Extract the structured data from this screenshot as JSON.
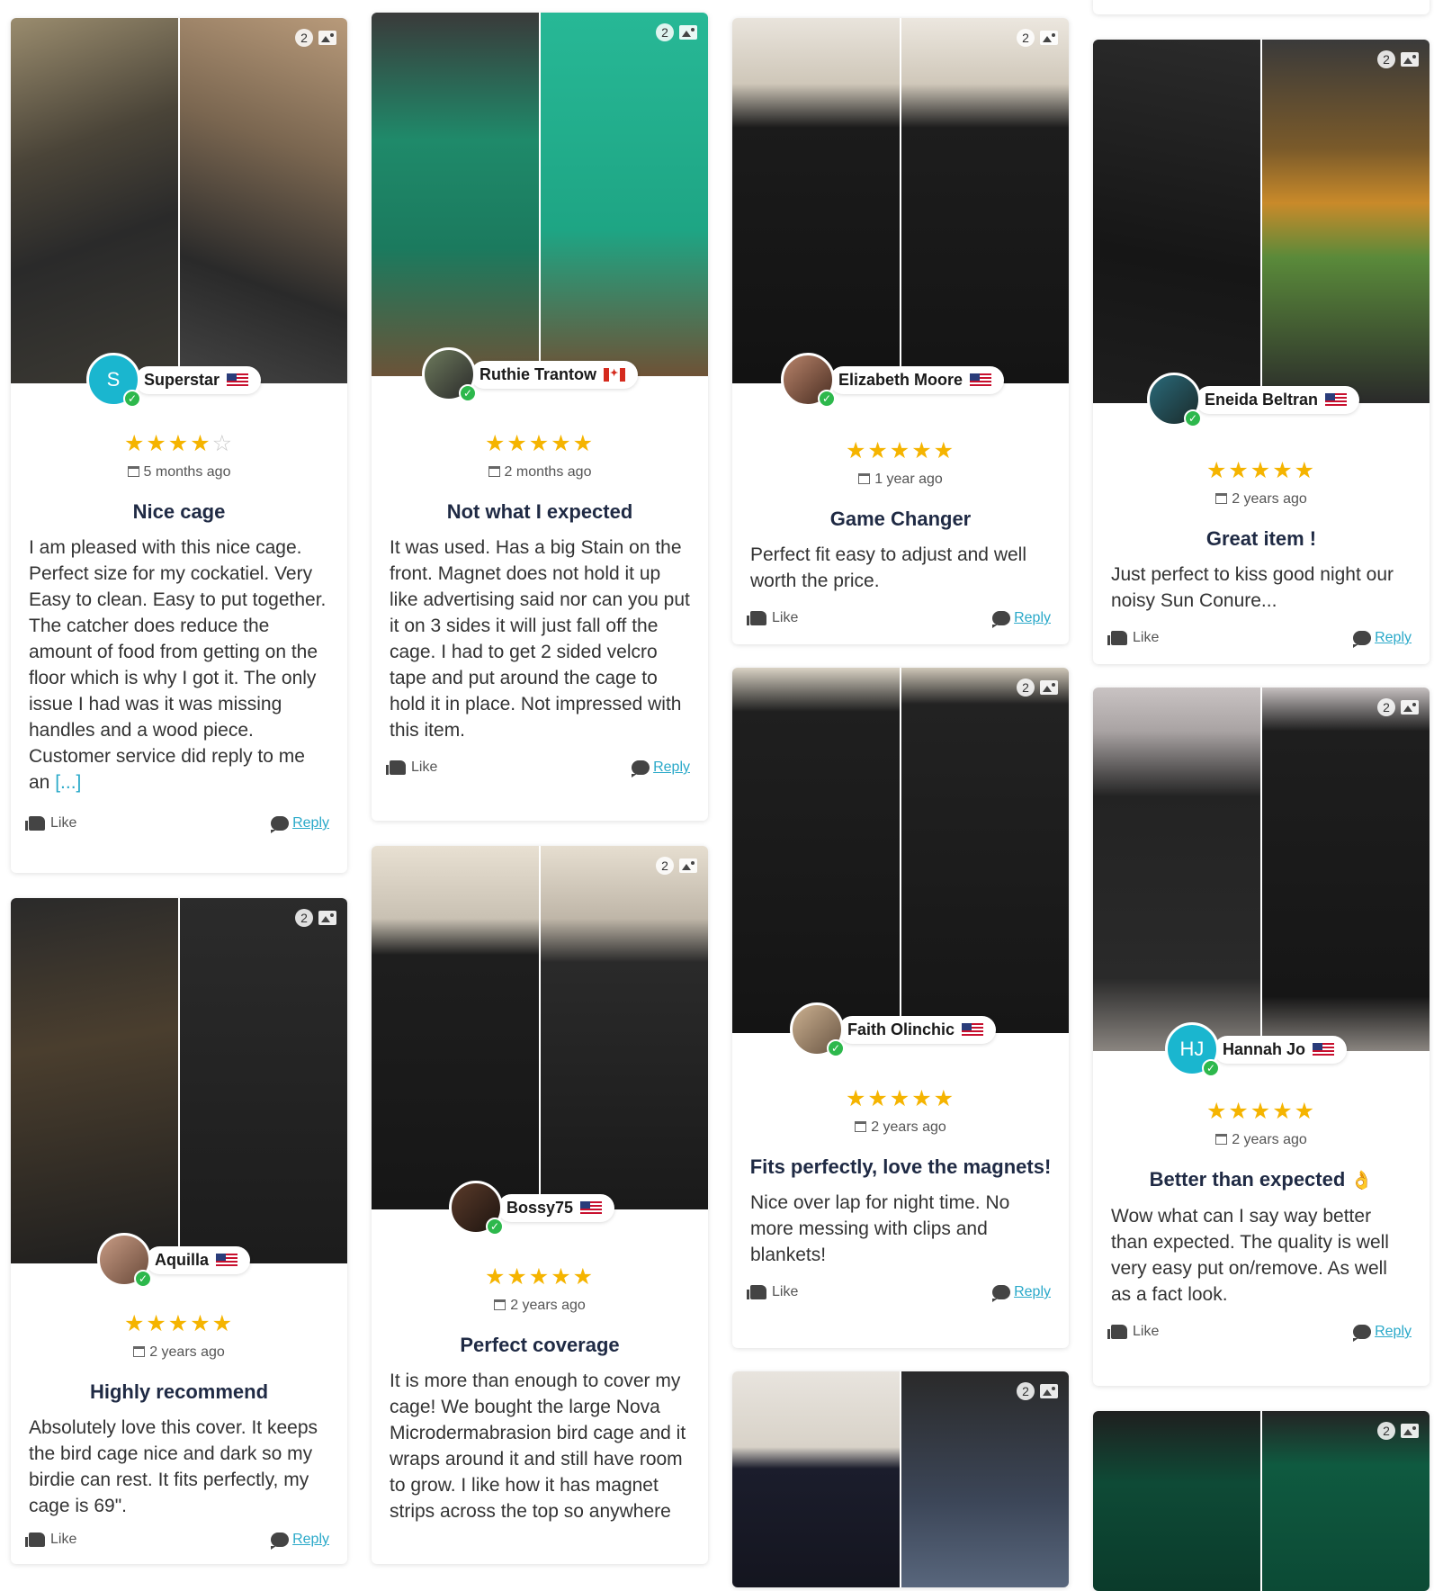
{
  "ui": {
    "like_label": "Like",
    "reply_label": "Reply",
    "photo_count": "2"
  },
  "reviews": [
    {
      "name": "Superstar",
      "initial": "S",
      "stars": "★★★★",
      "stars_off": "☆",
      "date": "5 months ago",
      "title": "Nice cage",
      "text": "I am pleased with this nice cage. Perfect size for my cockatiel. Very Easy to clean. Easy to put together. The catcher does reduce the amount of food from getting on the floor which is why I got it. The only issue I had was it was missing handles and a wood piece. Customer service did reply to me an",
      "more": "[...]"
    },
    {
      "name": "Ruthie Trantow",
      "stars": "★★★★★",
      "date": "2 months ago",
      "title": "Not what I expected",
      "text": "It was used. Has a big Stain on the front. Magnet does not hold it up like advertising said nor can you put it on 3 sides it will just fall off the cage. I had to get 2 sided velcro tape and put around the cage to hold it in place. Not impressed with this item."
    },
    {
      "name": "Elizabeth Moore",
      "stars": "★★★★★",
      "date": "1 year ago",
      "title": "Game Changer",
      "text": "Perfect fit easy to adjust and well worth the price."
    },
    {
      "name": "Eneida Beltran",
      "stars": "★★★★★",
      "date": "2 years ago",
      "title": "Great item !",
      "text": "Just perfect to kiss good night our noisy Sun Conure..."
    },
    {
      "name": "Aquilla",
      "stars": "★★★★★",
      "date": "2 years ago",
      "title": "Highly recommend",
      "text": "Absolutely love this cover. It keeps the bird cage nice and dark so my birdie can rest. It fits perfectly, my cage is 69\"."
    },
    {
      "name": "Bossy75",
      "stars": "★★★★★",
      "date": "2 years ago",
      "title": "Perfect coverage",
      "text": "It is more than enough to cover my cage! We bought the large Nova Microdermabrasion bird cage and it wraps around it and still have room to grow. I like how it has magnet strips across the top so anywhere"
    },
    {
      "name": "Faith Olinchic",
      "stars": "★★★★★",
      "date": "2 years ago",
      "title": "Fits perfectly, love the magnets!",
      "text": "Nice over lap for night time. No more messing with clips and blankets!"
    },
    {
      "name": "Hannah Jo",
      "initial": "HJ",
      "stars": "★★★★★",
      "date": "2 years ago",
      "title": "Better than expected",
      "title_emoji": "👌",
      "text": "Wow what can I say way better than expected. The quality is well very easy put on/remove. As well as a fact look."
    }
  ],
  "colors": {
    "accent": "#2aa9c9",
    "star": "#f5b400",
    "verified": "#2db84c",
    "title": "#1f2a44",
    "avatar_cyan": "#1ab6cf"
  }
}
